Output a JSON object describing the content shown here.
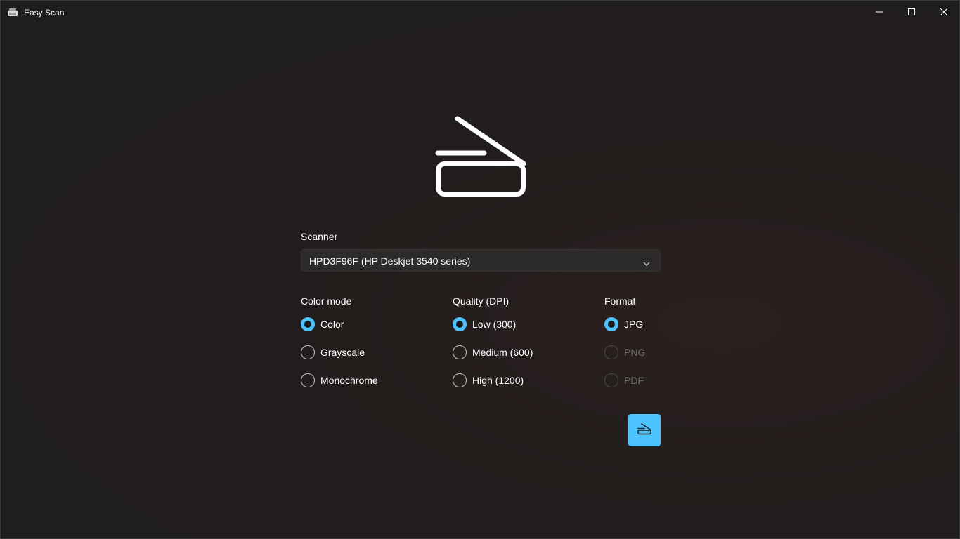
{
  "window": {
    "title": "Easy Scan",
    "app_icon": "scanner-app-icon",
    "controls": [
      "minimize-icon",
      "maximize-icon",
      "close-icon"
    ]
  },
  "hero": {
    "icon": "scanner-icon"
  },
  "scanner": {
    "label": "Scanner",
    "selected": "HPD3F96F (HP Deskjet 3540 series)",
    "dropdown_icon": "chevron-down-icon"
  },
  "color_mode": {
    "label": "Color mode",
    "options": [
      {
        "label": "Color",
        "checked": true,
        "enabled": true
      },
      {
        "label": "Grayscale",
        "checked": false,
        "enabled": true
      },
      {
        "label": "Monochrome",
        "checked": false,
        "enabled": true
      }
    ]
  },
  "quality": {
    "label": "Quality (DPI)",
    "options": [
      {
        "label": "Low (300)",
        "checked": true,
        "enabled": true
      },
      {
        "label": "Medium (600)",
        "checked": false,
        "enabled": true
      },
      {
        "label": "High (1200)",
        "checked": false,
        "enabled": true
      }
    ]
  },
  "format": {
    "label": "Format",
    "options": [
      {
        "label": "JPG",
        "checked": true,
        "enabled": true
      },
      {
        "label": "PNG",
        "checked": false,
        "enabled": false
      },
      {
        "label": "PDF",
        "checked": false,
        "enabled": false
      }
    ]
  },
  "scan_button": {
    "icon": "scanner-icon"
  },
  "colors": {
    "accent": "#4cc2ff",
    "background": "#1f1e1c",
    "text": "#ffffff",
    "disabled_text": "#6e6d6b"
  }
}
